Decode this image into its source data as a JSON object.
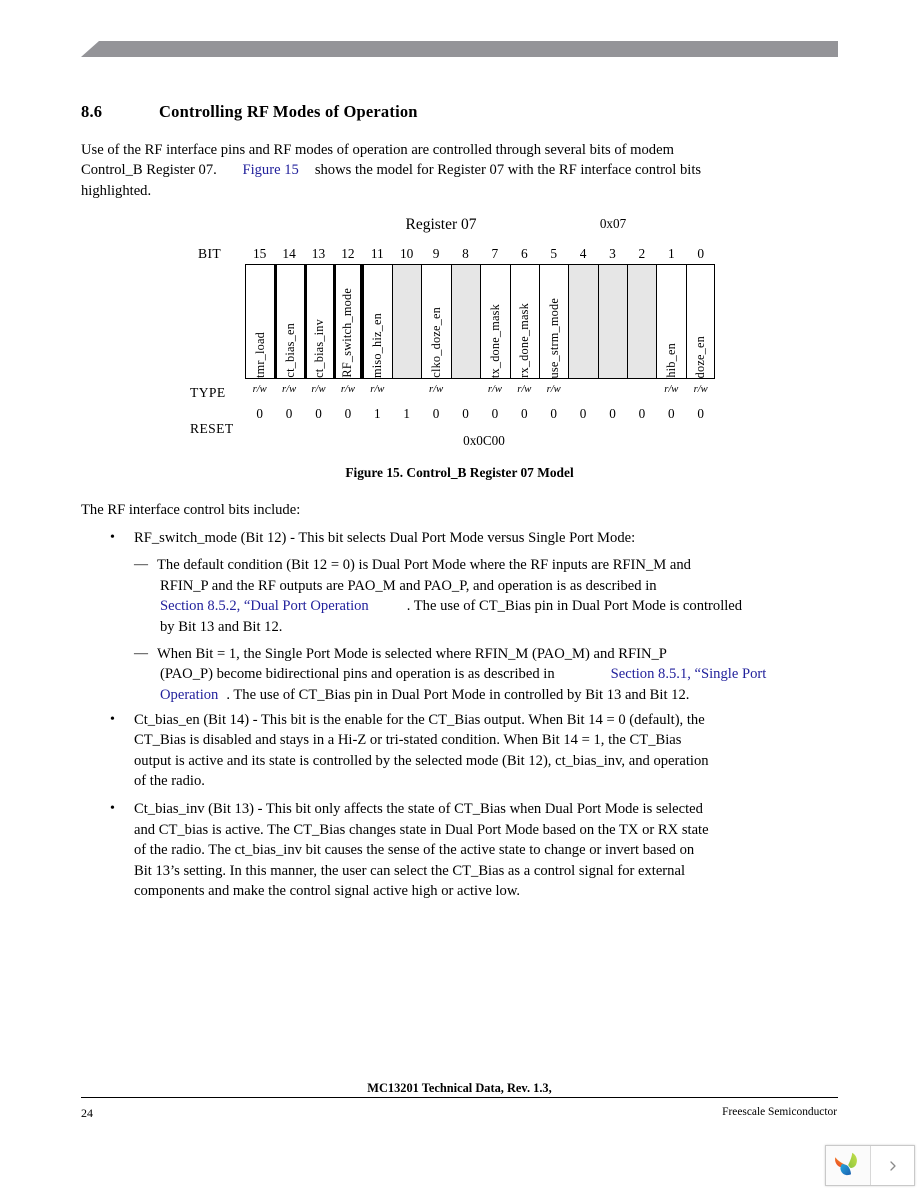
{
  "section": {
    "number": "8.6",
    "title": "Controlling RF Modes of Operation"
  },
  "intro": {
    "line1_a": "Use of the RF interface pins and RF modes of operation are controlled through several bits of modem",
    "line2_a": "Control_B Register 07.",
    "line2_link": "Figure 15",
    "line2_b": "shows the model for Register 07 with the RF interface control bits",
    "line3": "highlighted."
  },
  "figure": {
    "register_title": "Register 07",
    "register_address": "0x07",
    "bit_row_label": "BIT",
    "type_row_label": "TYPE",
    "reset_row_label": "RESET",
    "reset_hex": "0x0C00",
    "caption": "Figure 15. Control_B Register 07 Model",
    "bits": [
      {
        "bit": "15",
        "name": "tmr_load",
        "type": "r/w",
        "reset": "0",
        "shaded": false,
        "highlight": "none"
      },
      {
        "bit": "14",
        "name": "ct_bias_en",
        "type": "r/w",
        "reset": "0",
        "shaded": false,
        "highlight": "left"
      },
      {
        "bit": "13",
        "name": "ct_bias_inv",
        "type": "r/w",
        "reset": "0",
        "shaded": false,
        "highlight": "mid"
      },
      {
        "bit": "12",
        "name": "RF_switch_mode",
        "type": "r/w",
        "reset": "0",
        "shaded": false,
        "highlight": "right"
      },
      {
        "bit": "11",
        "name": "miso_hiz_en",
        "type": "r/w",
        "reset": "1",
        "shaded": false,
        "highlight": "none"
      },
      {
        "bit": "10",
        "name": "",
        "type": "",
        "reset": "1",
        "shaded": true,
        "highlight": "none"
      },
      {
        "bit": "9",
        "name": "clko_doze_en",
        "type": "r/w",
        "reset": "0",
        "shaded": false,
        "highlight": "none"
      },
      {
        "bit": "8",
        "name": "",
        "type": "",
        "reset": "0",
        "shaded": true,
        "highlight": "none"
      },
      {
        "bit": "7",
        "name": "tx_done_mask",
        "type": "r/w",
        "reset": "0",
        "shaded": false,
        "highlight": "none"
      },
      {
        "bit": "6",
        "name": "rx_done_mask",
        "type": "r/w",
        "reset": "0",
        "shaded": false,
        "highlight": "none"
      },
      {
        "bit": "5",
        "name": "use_strm_mode",
        "type": "r/w",
        "reset": "0",
        "shaded": false,
        "highlight": "none"
      },
      {
        "bit": "4",
        "name": "",
        "type": "",
        "reset": "0",
        "shaded": true,
        "highlight": "none"
      },
      {
        "bit": "3",
        "name": "",
        "type": "",
        "reset": "0",
        "shaded": true,
        "highlight": "none"
      },
      {
        "bit": "2",
        "name": "",
        "type": "",
        "reset": "0",
        "shaded": true,
        "highlight": "none"
      },
      {
        "bit": "1",
        "name": "hib_en",
        "type": "r/w",
        "reset": "0",
        "shaded": false,
        "highlight": "none"
      },
      {
        "bit": "0",
        "name": "doze_en",
        "type": "r/w",
        "reset": "0",
        "shaded": false,
        "highlight": "none"
      }
    ]
  },
  "body": {
    "lead": "The RF interface control bits include:",
    "bullet_marker": "•",
    "dash_marker": "—",
    "b1": {
      "text": "RF_switch_mode (Bit 12) - This bit selects Dual Port Mode versus Single Port Mode:",
      "d1_l1": "The default condition (Bit 12 = 0) is Dual Port Mode where the RF inputs are RFIN_M and",
      "d1_l2": "RFIN_P and the RF outputs are PAO_M and PAO_P, and operation is as described in",
      "d1_l3_link": "Section 8.5.2, “Dual Port Operation",
      "d1_l3_b": ". The use of CT_Bias pin in Dual Port Mode is controlled",
      "d1_l4": "by Bit 13 and Bit 12.",
      "d2_l1": "When Bit = 1, the Single Port Mode is selected where RFIN_M (PAO_M) and RFIN_P",
      "d2_l2_a": "(PAO_P) become bidirectional pins and operation is as described in",
      "d2_l2_link": "Section 8.5.1, “Single Port",
      "d2_l3_link": "Operation",
      "d2_l3_b": ". The use of CT_Bias pin in Dual Port Mode in controlled by Bit 13 and Bit 12."
    },
    "b2": {
      "l1": "Ct_bias_en (Bit 14) - This bit is the enable for the CT_Bias output. When Bit 14 = 0 (default), the",
      "l2": "CT_Bias is disabled and stays in a Hi-Z or tri-stated condition. When Bit 14 = 1, the CT_Bias",
      "l3": "output is active and its state is controlled by the selected mode (Bit 12), ct_bias_inv, and operation",
      "l4": "of the radio."
    },
    "b3": {
      "l1": "Ct_bias_inv (Bit 13) - This bit only affects the state of CT_Bias when Dual Port Mode is selected",
      "l2": "and CT_bias is active. The CT_Bias changes state in Dual Port Mode based on the TX or RX state",
      "l3": "of the radio. The ct_bias_inv bit causes the sense of the active state to change or invert based on",
      "l4": "Bit 13’s setting. In this manner, the user can select the CT_Bias as a control signal for external",
      "l5": "components and make the control signal active high or active low."
    }
  },
  "footer": {
    "center": "MC13201 Technical Data, Rev. 1.3,",
    "page_number": "24",
    "company": "Freescale Semiconductor"
  },
  "widget": {
    "logo_icon": "freescale-leaf-logo-icon",
    "next_icon": "chevron-right-icon"
  },
  "colors": {
    "link": "#22219c",
    "header_bar": "#949498",
    "shaded_cell": "#e6e6e6"
  }
}
